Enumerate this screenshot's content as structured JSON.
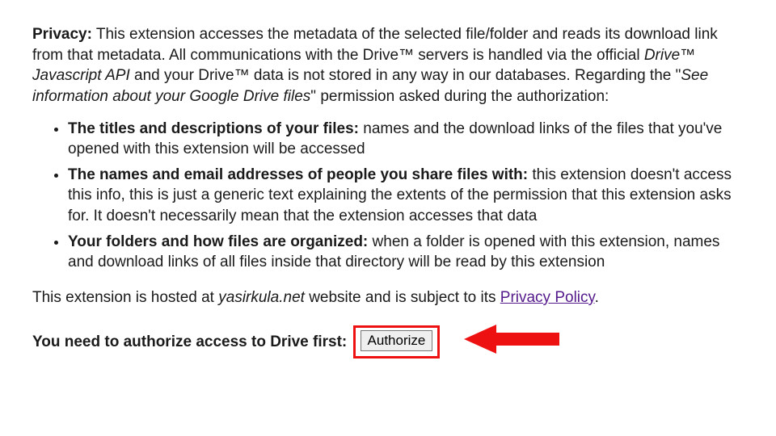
{
  "privacy": {
    "label": "Privacy:",
    "text_before_italic1": " This extension accesses the metadata of the selected file/folder and reads its download link from that metadata. All communications with the Drive™ servers is handled via the official ",
    "italic1": "Drive™ Javascript API",
    "text_mid1": " and your Drive™ data is not stored in any way in our databases. Regarding the \"",
    "italic2": "See information about your Google Drive files",
    "text_after_italic2": "\" permission asked during the authorization:"
  },
  "bullets": [
    {
      "bold": "The titles and descriptions of your files:",
      "rest": " names and the download links of the files that you've opened with this extension will be accessed"
    },
    {
      "bold": "The names and email addresses of people you share files with:",
      "rest": " this extension doesn't access this info, this is just a generic text explaining the extents of the permission that this extension asks for. It doesn't necessarily mean that the extension accesses that data"
    },
    {
      "bold": "Your folders and how files are organized:",
      "rest": " when a folder is opened with this extension, names and download links of all files inside that directory will be read by this extension"
    }
  ],
  "hosted": {
    "before": "This extension is hosted at ",
    "italic": "yasirkula.net",
    "mid": " website and is subject to its ",
    "link": "Privacy Policy",
    "after": "."
  },
  "auth": {
    "prompt": "You need to authorize access to Drive first:",
    "button": "Authorize"
  }
}
